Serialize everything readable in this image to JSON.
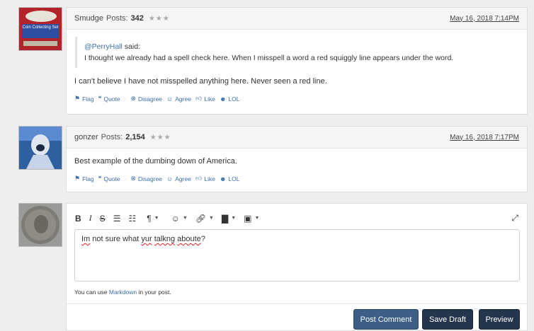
{
  "comments": [
    {
      "user": "Smudge",
      "posts_label": "Posts:",
      "posts_count": "342",
      "stars": "★★★",
      "date": "May 16, 2018 7:14PM",
      "quote": {
        "author": "@PerryHall",
        "said": "said:",
        "text": "I thought we already had a spell check here. When I misspell a word a red squiggly line appears under the word."
      },
      "text": "I can't believe I have not misspelled anything here. Never seen a red line."
    },
    {
      "user": "gonzer",
      "posts_label": "Posts:",
      "posts_count": "2,154",
      "stars": "★★★",
      "date": "May 16, 2018 7:17PM",
      "text": "Best example of the dumbing down of America."
    }
  ],
  "reactions": {
    "flag": "Flag",
    "quote": "Quote",
    "disagree": "Disagree",
    "agree": "Agree",
    "like": "Like",
    "lol": "LOL",
    "separator": "·"
  },
  "editor": {
    "toolbar": {
      "bold": "B",
      "italic": "I",
      "strike": "S"
    },
    "text_parts": [
      "Im",
      " not sure what ",
      "yur",
      " ",
      "talkng",
      " ",
      "aboute",
      "?"
    ],
    "hint_prefix": "You can use",
    "hint_link": "Markdown",
    "hint_suffix": "in your post.",
    "buttons": {
      "post": "Post Comment",
      "draft": "Save Draft",
      "preview": "Preview"
    }
  },
  "icons": {
    "flag": "flag-icon",
    "quote": "quote-icon",
    "disagree": "disagree-icon",
    "agree": "agree-icon",
    "like": "thumbs-up-icon",
    "lol": "lol-icon"
  },
  "colors": {
    "link": "#3c6fa7",
    "post_button": "#3d5f85",
    "dark_button": "#25354b",
    "spell_error": "#dd2222"
  }
}
